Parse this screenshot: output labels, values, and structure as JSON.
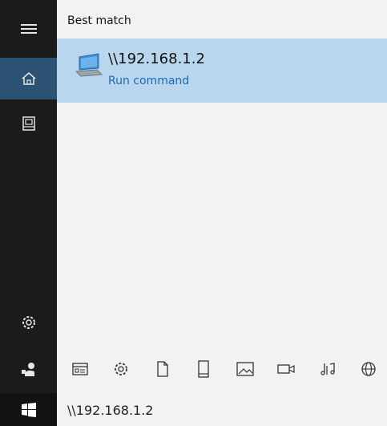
{
  "left_bar": {
    "items": [
      {
        "icon": "hamburger-menu-icon"
      },
      {
        "icon": "home-icon",
        "active": true
      },
      {
        "icon": "documents-icon"
      },
      {
        "icon": "settings-icon"
      },
      {
        "icon": "user-icon"
      }
    ]
  },
  "panel": {
    "section_label": "Best match",
    "result": {
      "title": "\\\\192.168.1.2",
      "subtitle": "Run command",
      "icon": "network-computer-icon"
    }
  },
  "filters": [
    {
      "icon": "apps-filter-icon"
    },
    {
      "icon": "settings-filter-icon"
    },
    {
      "icon": "document-filter-icon"
    },
    {
      "icon": "folder-filter-icon"
    },
    {
      "icon": "photos-filter-icon"
    },
    {
      "icon": "videos-filter-icon"
    },
    {
      "icon": "music-filter-icon"
    },
    {
      "icon": "web-filter-icon"
    }
  ],
  "taskbar": {
    "search_value": "\\\\192.168.1.2",
    "start_icon": "windows-logo-icon"
  },
  "colors": {
    "left_bar_bg": "#1b1b1b",
    "active_item_bg": "#2b5273",
    "result_highlight": "#b9d6ee",
    "subtitle_blue": "#1d68b0"
  }
}
